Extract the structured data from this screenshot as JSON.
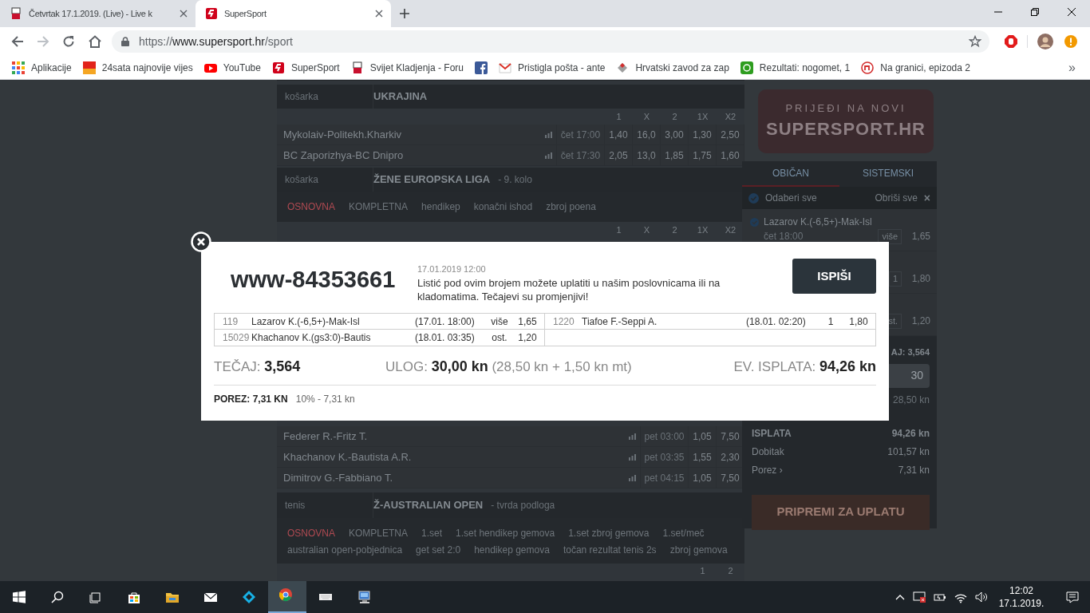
{
  "browser": {
    "tabs": [
      {
        "title": "Četvrtak 17.1.2019. (Live) - Live k",
        "selected": false
      },
      {
        "title": "SuperSport",
        "selected": true
      }
    ],
    "url": {
      "scheme": "https://",
      "host": "www.supersport.hr",
      "path": "/sport"
    },
    "bookmarks": [
      {
        "label": "Aplikacije"
      },
      {
        "label": "24sata najnovije vijes"
      },
      {
        "label": "YouTube"
      },
      {
        "label": "SuperSport"
      },
      {
        "label": "Svijet Kladjenja - Foru"
      },
      {
        "kind": "icon"
      },
      {
        "label": "Pristigla pošta - ante"
      },
      {
        "label": "Hrvatski zavod za zap"
      },
      {
        "label": "Rezultati: nogomet, 1"
      },
      {
        "label": "Na granici, epizoda 2"
      }
    ],
    "more": "»"
  },
  "sections": [
    {
      "sport": "košarka",
      "league": "UKRAJINA",
      "columns": [
        "1",
        "X",
        "2",
        "1X",
        "X2"
      ],
      "rows": [
        {
          "match": "Mykolaiv-Politekh.Kharkiv",
          "time": "čet 17:00",
          "odds": [
            {
              "value": "1,40",
              "selected": false
            },
            {
              "value": "16,0",
              "selected": false
            },
            {
              "value": "3,00",
              "selected": false
            },
            {
              "value": "1,30",
              "selected": false
            },
            {
              "value": "2,50",
              "selected": false
            }
          ]
        },
        {
          "match": "BC Zaporizhya-BC Dnipro",
          "time": "čet 17:30",
          "odds": [
            {
              "value": "2,05",
              "selected": false
            },
            {
              "value": "13,0",
              "selected": false
            },
            {
              "value": "1,85",
              "selected": false
            },
            {
              "value": "1,75",
              "selected": false
            },
            {
              "value": "1,60",
              "selected": false
            }
          ]
        }
      ]
    },
    {
      "sport": "košarka",
      "league": "ŽENE EUROPSKA LIGA",
      "subtitle": "- 9. kolo",
      "markets": [
        {
          "label": "OSNOVNA",
          "selected": true
        },
        {
          "label": "KOMPLETNA",
          "selected": false
        },
        {
          "label": "hendikep",
          "selected": false
        },
        {
          "label": "konačni ishod",
          "selected": false
        },
        {
          "label": "zbroj poena",
          "selected": false
        }
      ],
      "columns": [
        "1",
        "X",
        "2",
        "1X",
        "X2"
      ]
    }
  ],
  "rows_below": [
    {
      "match": "Federer R.-Fritz T.",
      "time": "pet 03:00",
      "odds": [
        {
          "value": "1,05",
          "selected": false
        },
        {
          "value": "7,50",
          "selected": false
        }
      ]
    },
    {
      "match": "Khachanov K.-Bautista A.R.",
      "time": "pet 03:35",
      "odds": [
        {
          "value": "1,55",
          "selected": false
        },
        {
          "value": "2,30",
          "selected": false
        }
      ]
    },
    {
      "match": "Dimitrov G.-Fabbiano T.",
      "time": "pet 04:15",
      "odds": [
        {
          "value": "1,05",
          "selected": false
        },
        {
          "value": "7,50",
          "selected": false
        }
      ]
    }
  ],
  "sections_below": [
    {
      "sport": "tenis",
      "league": "Ž-AUSTRALIAN OPEN",
      "subtitle": "- tvrda podloga",
      "markets": [
        {
          "label": "OSNOVNA",
          "selected": true
        },
        {
          "label": "KOMPLETNA",
          "selected": false
        },
        {
          "label": "1.set",
          "selected": false
        },
        {
          "label": "1.set hendikep gemova",
          "selected": false
        },
        {
          "label": "1.set zbroj gemova",
          "selected": false
        },
        {
          "label": "1.set/meč",
          "selected": false
        },
        {
          "label": "australian open-pobjednica",
          "selected": false
        },
        {
          "label": "get set 2:0",
          "selected": false
        },
        {
          "label": "hendikep gemova",
          "selected": false
        },
        {
          "label": "točan rezultat tenis 2s",
          "selected": false
        },
        {
          "label": "zbroj gemova",
          "selected": false
        }
      ],
      "columns": [
        "1",
        "2"
      ]
    }
  ],
  "banner": {
    "line1": "PRIJEĐI NA NOVI",
    "line2": "SUPERSPORT.HR"
  },
  "betslip": {
    "tabs": [
      {
        "label": "OBIČAN",
        "selected": true
      },
      {
        "label": "SISTEMSKI",
        "selected": false
      }
    ],
    "select_all": {
      "label": "Odaberi sve",
      "checked": true
    },
    "clear_all": "Obriši sve",
    "clear_icon": "×",
    "selections": [
      {
        "match": "Lazarov K.(-6,5+)-Mak-Isl",
        "time": "čet 18:00",
        "pick": "više",
        "odds": "1,65",
        "checked": true
      },
      {
        "pick": "1",
        "odds": "1,80"
      },
      {
        "pick": "st.",
        "odds": "1,20"
      }
    ],
    "total_odds": "AJ: 3,564",
    "stake": "30",
    "stake_net": "28,50 kn",
    "summary": [
      {
        "label": "ISPLATA",
        "value": "94,26 kn",
        "kind": "bold"
      },
      {
        "label": "Dobitak",
        "value": "101,57 kn",
        "kind": "plain"
      },
      {
        "label": "Porez ›",
        "value": "7,31 kn",
        "kind": "plain"
      }
    ],
    "submit": "PRIPREMI ZA UPLATU"
  },
  "modal": {
    "ticket": "www-84353661",
    "date": "17.01.2019 12:00",
    "message": "Listić pod ovim brojem možete uplatiti u našim poslovnicama ili na kladomatima. Tečajevi su promjenjivi!",
    "print": "ISPIŠI",
    "bets": [
      {
        "id": "119",
        "match": "Lazarov K.(-6,5+)-Mak-Isl",
        "date": "(17.01. 18:00)",
        "pick": "više",
        "odds": "1,65"
      },
      {
        "id": "1220",
        "match": "Tiafoe F.-Seppi A.",
        "date": "(18.01. 02:20)",
        "pick": "1",
        "odds": "1,80"
      },
      {
        "id": "15029",
        "match": "Khachanov K.(gs3:0)-Bautis",
        "date": "(18.01. 03:35)",
        "pick": "ost.",
        "odds": "1,20"
      }
    ],
    "odds_label": "TEČAJ:",
    "odds_value": "3,564",
    "stake_label": "ULOG:",
    "stake_value": "30,00 kn",
    "stake_detail": "(28,50 kn + 1,50 kn mt)",
    "payout_label": "EV. ISPLATA:",
    "payout_value": "94,26 kn",
    "tax_label": "POREZ:",
    "tax_value": "7,31 KN",
    "tax_detail": "10% - 7,31 kn"
  },
  "taskbar": {
    "apps": [
      {
        "selected": false
      },
      {
        "selected": false
      },
      {
        "selected": false
      },
      {
        "selected": false
      },
      {
        "selected": false
      },
      {
        "selected": false
      },
      {
        "selected": false
      },
      {
        "selected": true
      },
      {
        "selected": false
      },
      {
        "selected": false
      }
    ],
    "time": "12:02",
    "date": "17.1.2019."
  }
}
